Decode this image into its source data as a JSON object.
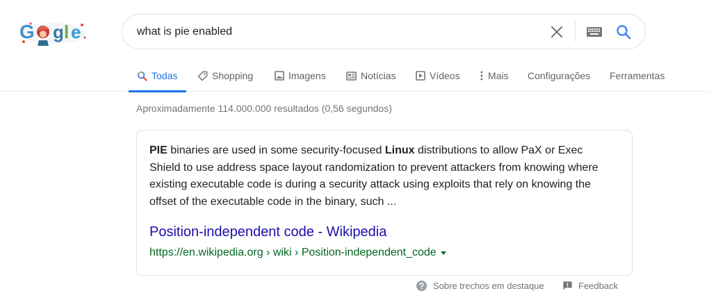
{
  "search": {
    "query": "what is pie enabled"
  },
  "logo": {
    "text": "Google"
  },
  "tabs": [
    {
      "label": "Todas",
      "icon": "search-icon",
      "active": true
    },
    {
      "label": "Shopping",
      "icon": "tag-icon"
    },
    {
      "label": "Imagens",
      "icon": "image-icon"
    },
    {
      "label": "Notícias",
      "icon": "news-icon"
    },
    {
      "label": "Vídeos",
      "icon": "play-icon"
    },
    {
      "label": "Mais",
      "icon": "more-vert-icon"
    },
    {
      "label": "Configurações"
    },
    {
      "label": "Ferramentas"
    }
  ],
  "result_stats": "Aproximadamente 114.000.000 resultados (0,56 segundos)",
  "snippet": {
    "text_parts": [
      {
        "text": "PIE",
        "bold": true
      },
      {
        "text": " binaries are used in some security-focused ",
        "bold": false
      },
      {
        "text": "Linux",
        "bold": true
      },
      {
        "text": " distributions to allow PaX or Exec Shield to use address space layout randomization to prevent attackers from knowing where existing executable code is during a security attack using exploits that rely on knowing the offset of the executable code in the binary, such ...",
        "bold": false
      }
    ],
    "title": "Position-independent code - Wikipedia",
    "url": "https://en.wikipedia.org › wiki › Position-independent_code"
  },
  "footer": {
    "about_label": "Sobre trechos em destaque",
    "feedback_label": "Feedback"
  },
  "colors": {
    "accent": "#1a73e8",
    "link": "#1a0dab",
    "url": "#006621",
    "muted": "#70757a"
  }
}
